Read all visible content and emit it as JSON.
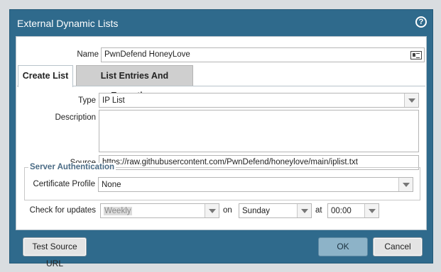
{
  "dialog": {
    "title": "External Dynamic Lists",
    "help_icon": "question-circle-icon"
  },
  "name": {
    "label": "Name",
    "value": "PwnDefend HoneyLove"
  },
  "tabs": [
    {
      "label": "Create List",
      "active": true
    },
    {
      "label": "List Entries And Exceptions",
      "active": false
    }
  ],
  "type": {
    "label": "Type",
    "value": "IP List"
  },
  "description": {
    "label": "Description",
    "value": ""
  },
  "source": {
    "label": "Source",
    "value": "https://raw.githubusercontent.com/PwnDefend/honeylove/main/iplist.txt"
  },
  "server_auth": {
    "legend": "Server Authentication",
    "cert_label": "Certificate Profile",
    "cert_value": "None"
  },
  "updates": {
    "label": "Check for updates",
    "frequency": "Weekly",
    "on_label": "on",
    "day": "Sunday",
    "at_label": "at",
    "time": "00:00"
  },
  "buttons": {
    "test_source": "Test Source URL",
    "ok": "OK",
    "cancel": "Cancel"
  },
  "colors": {
    "titlebar": "#2f6a8c",
    "ok_button": "#8db3c8",
    "legend_text": "#4a6b85"
  }
}
